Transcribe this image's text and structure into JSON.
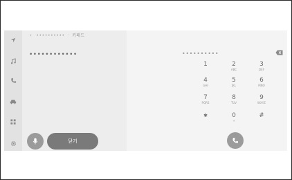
{
  "breadcrumb": {
    "back_glyph": "‹",
    "path_masked": "••••••••••",
    "separator": "·",
    "current": "키패드"
  },
  "contact": {
    "masked_number": "••••••••••••"
  },
  "buttons": {
    "close_label": "닫기"
  },
  "dial": {
    "entry_masked": "••••••••••",
    "keys": [
      {
        "digit": "1",
        "letters": ""
      },
      {
        "digit": "2",
        "letters": "ABC"
      },
      {
        "digit": "3",
        "letters": "DEF"
      },
      {
        "digit": "4",
        "letters": "GHI"
      },
      {
        "digit": "5",
        "letters": "JKL"
      },
      {
        "digit": "6",
        "letters": "MNO"
      },
      {
        "digit": "7",
        "letters": "PQRS"
      },
      {
        "digit": "8",
        "letters": "TUV"
      },
      {
        "digit": "9",
        "letters": "WXYZ"
      },
      {
        "digit": "✱",
        "letters": ""
      },
      {
        "digit": "0",
        "letters": "+"
      },
      {
        "digit": "#",
        "letters": ""
      }
    ]
  },
  "icons": {
    "rail": [
      "navigation-icon",
      "music-icon",
      "phone-icon",
      "car-icon",
      "apps-icon",
      "settings-icon"
    ],
    "mic": "mic-icon",
    "call": "call-icon",
    "backspace": "backspace-icon"
  },
  "colors": {
    "button_gray": "#9b9b9b",
    "close_button": "#7a7a7a",
    "panel_left": "#ededed",
    "panel_right": "#f4f4f4"
  }
}
